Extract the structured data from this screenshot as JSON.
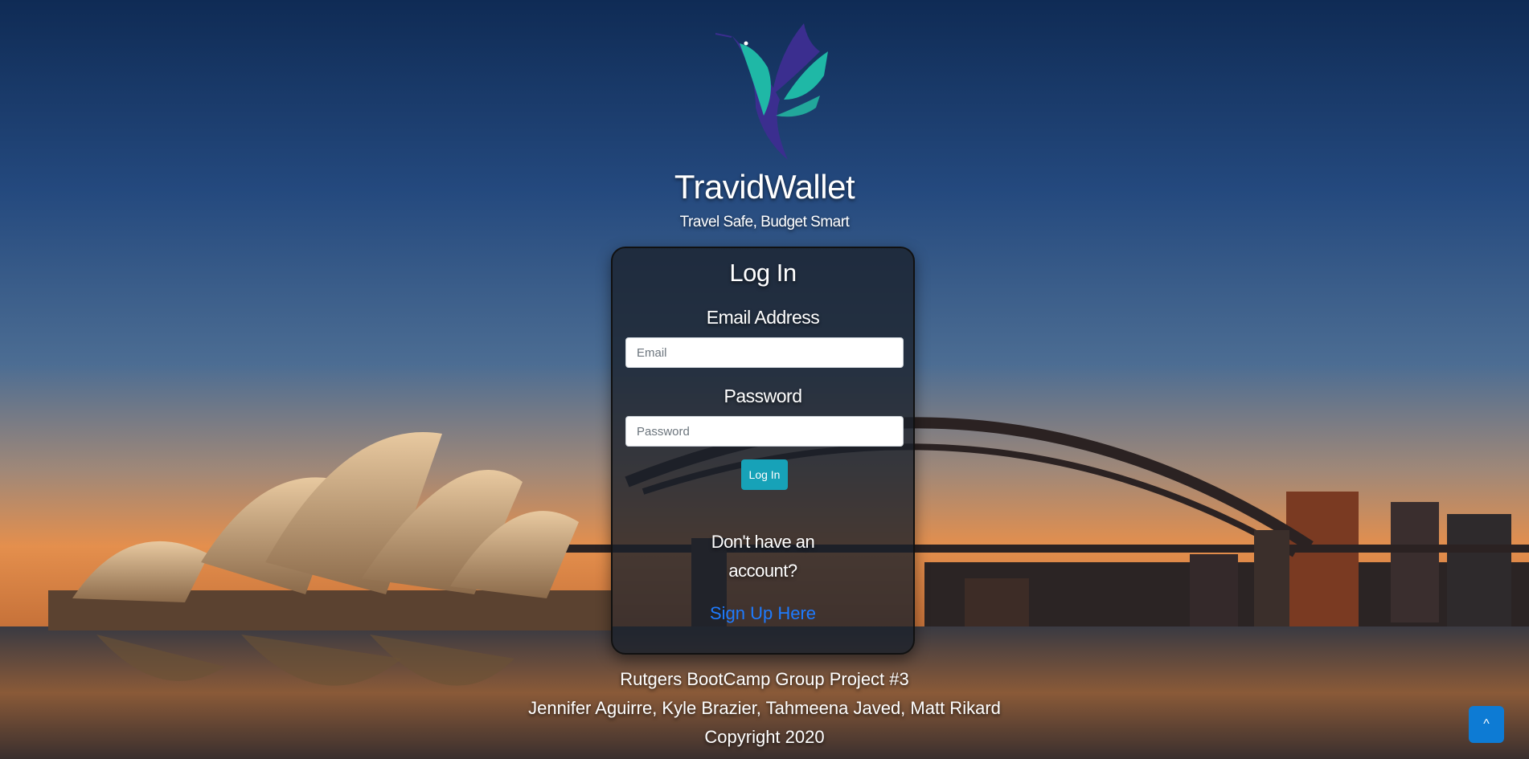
{
  "brand": {
    "title": "TravidWallet",
    "tagline": "Travel Safe, Budget Smart",
    "logo_icon": "hummingbird-icon"
  },
  "login_card": {
    "heading": "Log In",
    "email_label": "Email Address",
    "email_placeholder": "Email",
    "email_value": "",
    "password_label": "Password",
    "password_placeholder": "Password",
    "password_value": "",
    "login_button": "Log In",
    "no_account_text": "Don't have an account?",
    "signup_link": "Sign Up Here"
  },
  "footer": {
    "project": "Rutgers BootCamp Group Project #3",
    "authors": "Jennifer Aguirre, Kyle Brazier, Tahmeena Javed, Matt Rikard",
    "copyright": "Copyright 2020"
  },
  "scroll_top_button": "^",
  "colors": {
    "accent_teal": "#17a2b8",
    "link_blue": "#1e7bff",
    "scroll_button_blue": "#0d7bd4",
    "logo_teal": "#1fb8a6",
    "logo_purple": "#3b2e8f"
  }
}
